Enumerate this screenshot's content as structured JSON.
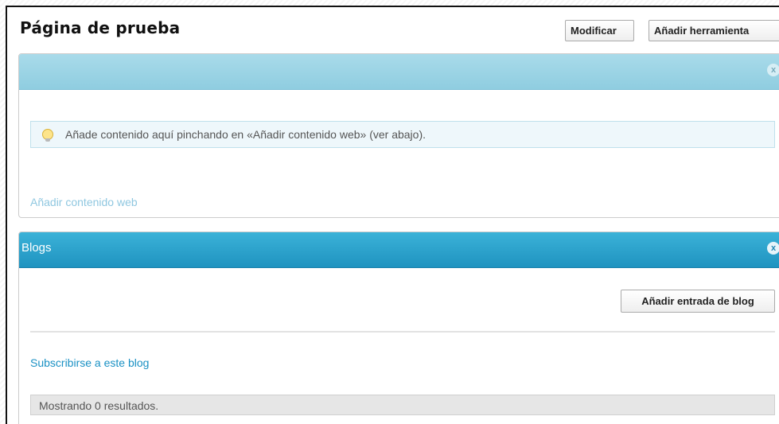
{
  "page": {
    "title": "Página de prueba"
  },
  "toolbar": {
    "modify_label": "Modificar",
    "add_tool_label": "Añadir herramienta"
  },
  "portlet_web_content": {
    "close_glyph": "x",
    "info_message": "Añade contenido aquí pinchando en «Añadir contenido web» (ver abajo).",
    "info_icon": "lightbulb-icon",
    "add_link": "Añadir contenido web"
  },
  "portlet_blogs": {
    "title": "Blogs",
    "close_glyph": "x",
    "add_entry_label": "Añadir entrada de blog",
    "subscribe_link": "Subscribirse a este blog",
    "results_text": "Mostrando 0 resultados."
  },
  "colors": {
    "header_light": "#a9dbea",
    "header_dark": "#1f93c0",
    "link": "#1a91c4"
  }
}
